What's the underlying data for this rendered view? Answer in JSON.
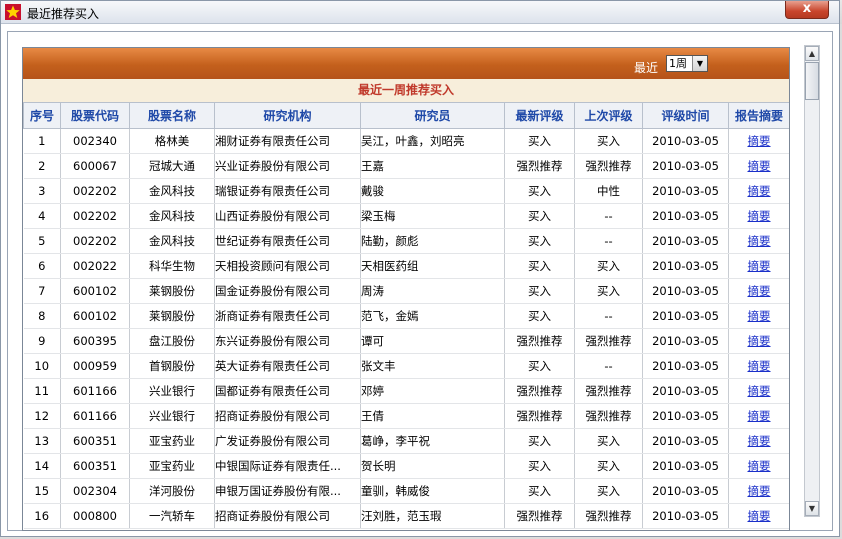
{
  "window": {
    "title": "最近推荐买入",
    "close_label": "x"
  },
  "toolbar": {
    "recent_label": "最近",
    "period_value": "1周"
  },
  "section": {
    "title": "最近一周推荐买入"
  },
  "columns": [
    "序号",
    "股票代码",
    "股票名称",
    "研究机构",
    "研究员",
    "最新评级",
    "上次评级",
    "评级时间",
    "报告摘要"
  ],
  "rows": [
    {
      "no": "1",
      "code": "002340",
      "name": "格林美",
      "org": "湘财证券有限责任公司",
      "analyst": "吴江，叶鑫，刘昭亮",
      "latest": "买入",
      "prev": "买入",
      "date": "2010-03-05",
      "summary": "摘要"
    },
    {
      "no": "2",
      "code": "600067",
      "name": "冠城大通",
      "org": "兴业证券股份有限公司",
      "analyst": "王嘉",
      "latest": "强烈推荐",
      "prev": "强烈推荐",
      "date": "2010-03-05",
      "summary": "摘要"
    },
    {
      "no": "3",
      "code": "002202",
      "name": "金风科技",
      "org": "瑞银证券有限责任公司",
      "analyst": "戴骏",
      "latest": "买入",
      "prev": "中性",
      "date": "2010-03-05",
      "summary": "摘要"
    },
    {
      "no": "4",
      "code": "002202",
      "name": "金风科技",
      "org": "山西证券股份有限公司",
      "analyst": "梁玉梅",
      "latest": "买入",
      "prev": "--",
      "date": "2010-03-05",
      "summary": "摘要"
    },
    {
      "no": "5",
      "code": "002202",
      "name": "金风科技",
      "org": "世纪证券有限责任公司",
      "analyst": "陆勤，颜彪",
      "latest": "买入",
      "prev": "--",
      "date": "2010-03-05",
      "summary": "摘要"
    },
    {
      "no": "6",
      "code": "002022",
      "name": "科华生物",
      "org": "天相投资顾问有限公司",
      "analyst": "天相医药组",
      "latest": "买入",
      "prev": "买入",
      "date": "2010-03-05",
      "summary": "摘要"
    },
    {
      "no": "7",
      "code": "600102",
      "name": "莱钢股份",
      "org": "国金证券股份有限公司",
      "analyst": "周涛",
      "latest": "买入",
      "prev": "买入",
      "date": "2010-03-05",
      "summary": "摘要"
    },
    {
      "no": "8",
      "code": "600102",
      "name": "莱钢股份",
      "org": "浙商证券有限责任公司",
      "analyst": "范飞，金嫣",
      "latest": "买入",
      "prev": "--",
      "date": "2010-03-05",
      "summary": "摘要"
    },
    {
      "no": "9",
      "code": "600395",
      "name": "盘江股份",
      "org": "东兴证券股份有限公司",
      "analyst": "谭可",
      "latest": "强烈推荐",
      "prev": "强烈推荐",
      "date": "2010-03-05",
      "summary": "摘要"
    },
    {
      "no": "10",
      "code": "000959",
      "name": "首钢股份",
      "org": "英大证券有限责任公司",
      "analyst": "张文丰",
      "latest": "买入",
      "prev": "--",
      "date": "2010-03-05",
      "summary": "摘要"
    },
    {
      "no": "11",
      "code": "601166",
      "name": "兴业银行",
      "org": "国都证券有限责任公司",
      "analyst": "邓婷",
      "latest": "强烈推荐",
      "prev": "强烈推荐",
      "date": "2010-03-05",
      "summary": "摘要"
    },
    {
      "no": "12",
      "code": "601166",
      "name": "兴业银行",
      "org": "招商证券股份有限公司",
      "analyst": "王倩",
      "latest": "强烈推荐",
      "prev": "强烈推荐",
      "date": "2010-03-05",
      "summary": "摘要"
    },
    {
      "no": "13",
      "code": "600351",
      "name": "亚宝药业",
      "org": "广发证券股份有限公司",
      "analyst": "葛峥，李平祝",
      "latest": "买入",
      "prev": "买入",
      "date": "2010-03-05",
      "summary": "摘要"
    },
    {
      "no": "14",
      "code": "600351",
      "name": "亚宝药业",
      "org": "中银国际证券有限责任...",
      "analyst": "贺长明",
      "latest": "买入",
      "prev": "买入",
      "date": "2010-03-05",
      "summary": "摘要"
    },
    {
      "no": "15",
      "code": "002304",
      "name": "洋河股份",
      "org": "申银万国证券股份有限...",
      "analyst": "童驯，韩威俊",
      "latest": "买入",
      "prev": "买入",
      "date": "2010-03-05",
      "summary": "摘要"
    },
    {
      "no": "16",
      "code": "000800",
      "name": "一汽轿车",
      "org": "招商证券股份有限公司",
      "analyst": "汪刘胜，范玉瑕",
      "latest": "强烈推荐",
      "prev": "强烈推荐",
      "date": "2010-03-05",
      "summary": "摘要"
    }
  ],
  "scrollbar": {
    "up": "▲",
    "down": "▼"
  }
}
